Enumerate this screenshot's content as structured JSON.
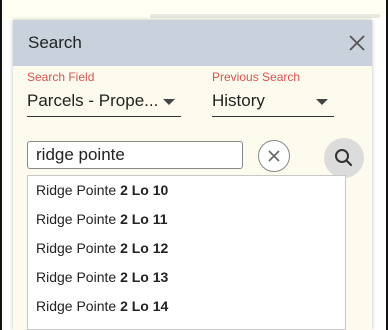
{
  "panel": {
    "title": "Search",
    "close_icon": "close-icon"
  },
  "search_field": {
    "label": "Search Field",
    "value": "Parcels - Prope..."
  },
  "previous_search": {
    "label": "Previous Search",
    "value": "History"
  },
  "search": {
    "value": "ridge pointe",
    "clear_icon": "clear-x-circle-icon",
    "search_icon": "magnifier-icon"
  },
  "suggestions": [
    {
      "prefix": "Ridge Pointe ",
      "bold": "2 Lo 10"
    },
    {
      "prefix": "Ridge Pointe ",
      "bold": "2 Lo 11"
    },
    {
      "prefix": "Ridge Pointe ",
      "bold": "2 Lo 12"
    },
    {
      "prefix": "Ridge Pointe ",
      "bold": "2 Lo 13"
    },
    {
      "prefix": "Ridge Pointe ",
      "bold": "2 Lo 14"
    }
  ]
}
